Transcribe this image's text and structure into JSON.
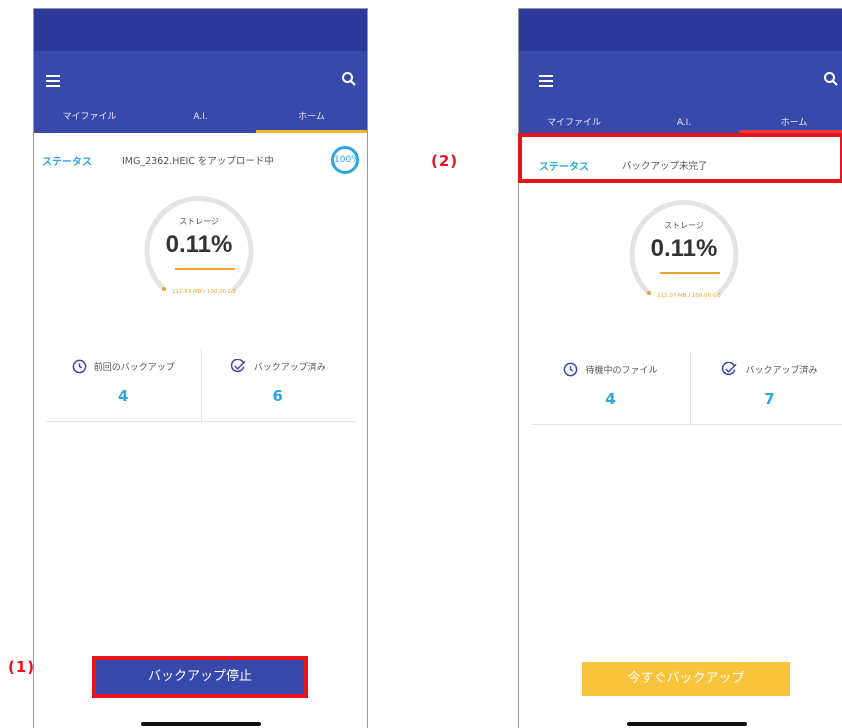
{
  "colors": {
    "accent": "#3949ab",
    "status_bar": "#2c399a",
    "highlight": "#e8131b",
    "info": "#2aa7e0",
    "storage": "#f0a030",
    "backup_now": "#f9c43b"
  },
  "callouts": {
    "one": "(1)",
    "two": "(2)"
  },
  "screen1": {
    "tabs": [
      "マイファイル",
      "A.I.",
      "ホーム"
    ],
    "status_label": "ステータス",
    "status_text": "IMG_2362.HEIC をアップロード中",
    "progress_badge": "100%",
    "gauge": {
      "title": "ストレージ",
      "value": "0.11%",
      "detail": "111.53 MB / 100.00 GB"
    },
    "stat_left": {
      "label": "前回のバックアップ",
      "value": "4",
      "icon": "clock-icon"
    },
    "stat_right": {
      "label": "バックアップ済み",
      "value": "6",
      "icon": "check-circle-icon"
    },
    "button": "バックアップ停止"
  },
  "screen2": {
    "tabs": [
      "マイファイル",
      "A.I.",
      "ホーム"
    ],
    "status_label": "ステータス",
    "status_text": "バックアップ未完了",
    "gauge": {
      "title": "ストレージ",
      "value": "0.11%",
      "detail": "113.07 MB / 100.00 GB"
    },
    "stat_left": {
      "label": "待機中のファイル",
      "value": "4",
      "icon": "clock-icon"
    },
    "stat_right": {
      "label": "バックアップ済み",
      "value": "7",
      "icon": "check-circle-icon"
    },
    "button": "今すぐバックアップ"
  }
}
